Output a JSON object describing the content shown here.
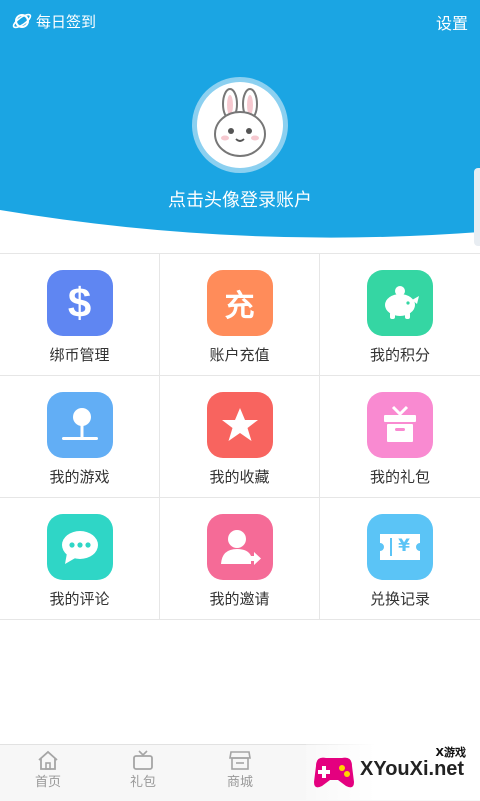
{
  "header": {
    "signin_label": "每日签到",
    "settings_label": "设置",
    "login_prompt": "点击头像登录账户",
    "bg_color": "#1ba5e3"
  },
  "grid": [
    {
      "label": "绑币管理",
      "icon": "dollar-icon",
      "color": "#5f86f2"
    },
    {
      "label": "账户充值",
      "icon": "recharge-icon",
      "color": "#ff8c5a"
    },
    {
      "label": "我的积分",
      "icon": "piggy-bank-icon",
      "color": "#35d6a3"
    },
    {
      "label": "我的游戏",
      "icon": "joystick-icon",
      "color": "#62aef5"
    },
    {
      "label": "我的收藏",
      "icon": "star-icon",
      "color": "#f8645f"
    },
    {
      "label": "我的礼包",
      "icon": "gift-icon",
      "color": "#f98ad1"
    },
    {
      "label": "我的评论",
      "icon": "comment-icon",
      "color": "#2fd6c6"
    },
    {
      "label": "我的邀请",
      "icon": "invite-icon",
      "color": "#f56b97"
    },
    {
      "label": "兑换记录",
      "icon": "ticket-icon",
      "color": "#5bc4f6"
    }
  ],
  "tile_glyphs": {
    "dollar": "$",
    "recharge": "充",
    "yen": "¥"
  },
  "tabs": [
    {
      "label": "首页",
      "icon": "home-icon"
    },
    {
      "label": "礼包",
      "icon": "gift-tv-icon"
    },
    {
      "label": "商城",
      "icon": "store-icon"
    }
  ],
  "watermark": {
    "cn": "X游戏",
    "en": "XYouXi.net"
  }
}
